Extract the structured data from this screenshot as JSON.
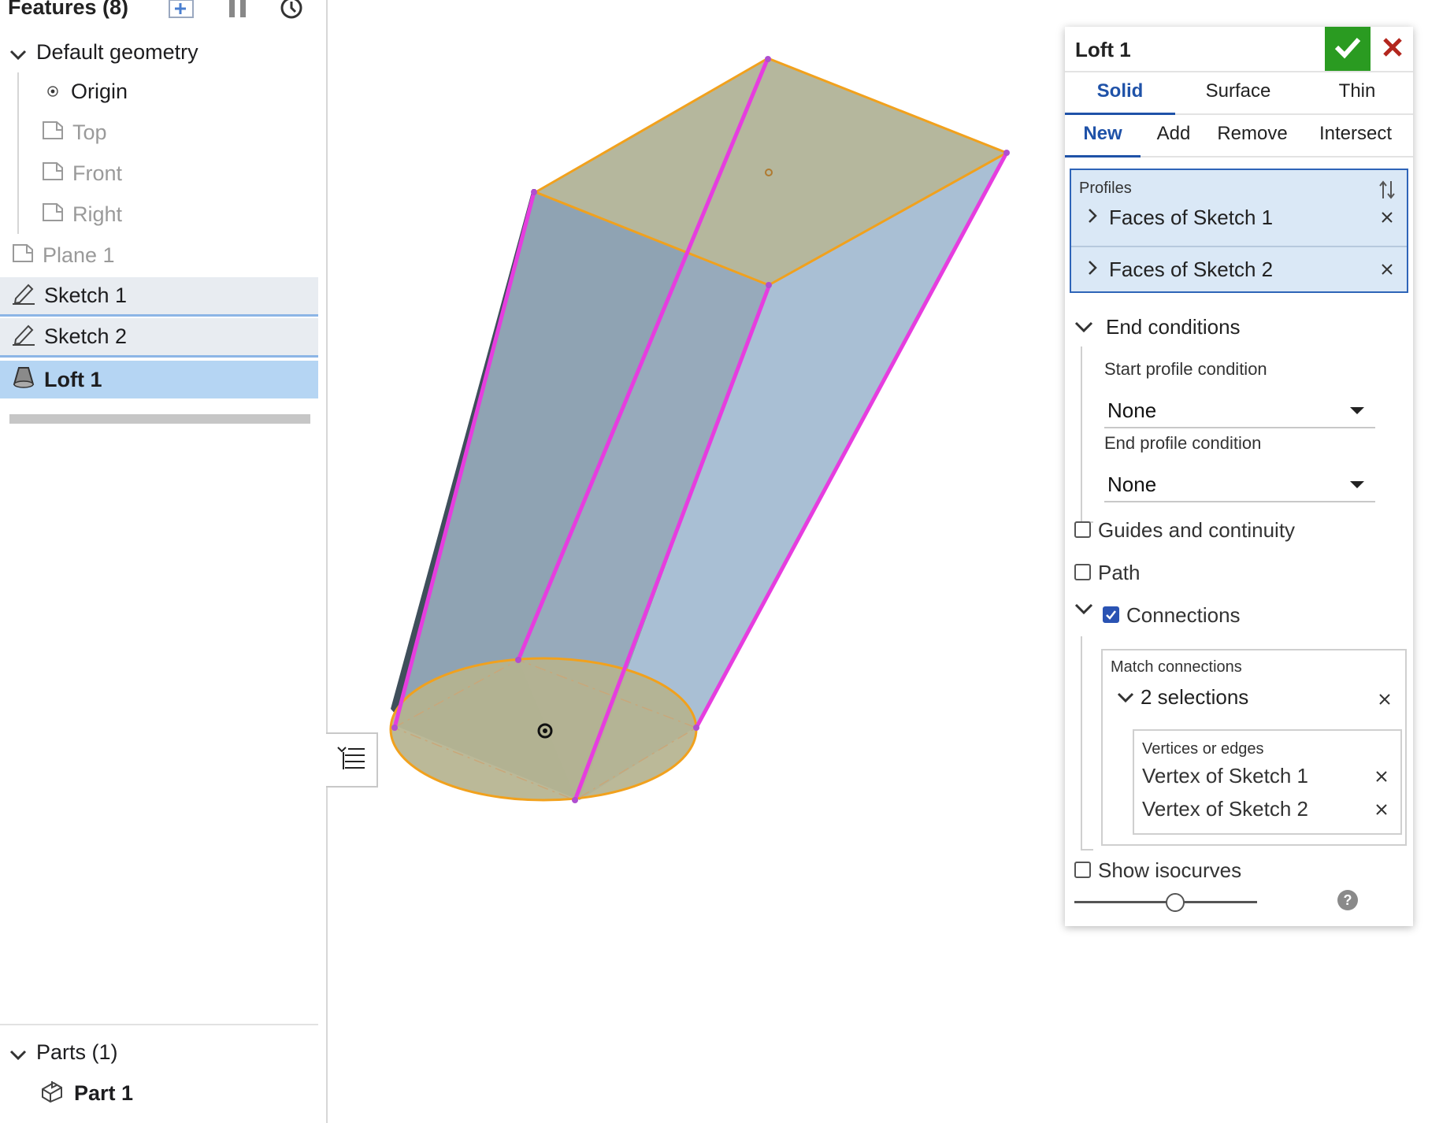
{
  "feature_tree": {
    "header": "Features (8)",
    "icons": [
      "add-feature-icon",
      "pause-icon",
      "history-icon"
    ],
    "default_geometry": "Default geometry",
    "origin": "Origin",
    "planes": [
      "Top",
      "Front",
      "Right"
    ],
    "items": [
      "Plane 1",
      "Sketch 1",
      "Sketch 2",
      "Loft 1"
    ],
    "parts_header": "Parts (1)",
    "part": "Part 1"
  },
  "dialog": {
    "title": "Loft 1",
    "body_tabs": [
      "Solid",
      "Surface",
      "Thin"
    ],
    "body_tab_selected": "Solid",
    "op_tabs": [
      "New",
      "Add",
      "Remove",
      "Intersect"
    ],
    "op_tab_selected": "New",
    "profiles_label": "Profiles",
    "profiles": [
      "Faces of Sketch 1",
      "Faces of Sketch 2"
    ],
    "end_conditions": "End conditions",
    "start_label": "Start profile condition",
    "start_value": "None",
    "end_label": "End profile condition",
    "end_value": "None",
    "guides": "Guides and continuity",
    "path": "Path",
    "connections": "Connections",
    "match_label": "Match connections",
    "selections": "2 selections",
    "vertices_label": "Vertices or edges",
    "vertices": [
      "Vertex of Sketch 1",
      "Vertex of Sketch 2"
    ],
    "isocurves": "Show isocurves",
    "help": "?"
  },
  "checkboxes": {
    "guides": false,
    "path": false,
    "connections": true,
    "isocurves": false
  },
  "colors": {
    "accent": "#1f52a8",
    "ok": "#2a9b21",
    "cancel": "#b3261e",
    "edge_highlight": "#e63ddf",
    "profile_edge": "#f1a11d",
    "solid_face": "#9fb6c9"
  }
}
